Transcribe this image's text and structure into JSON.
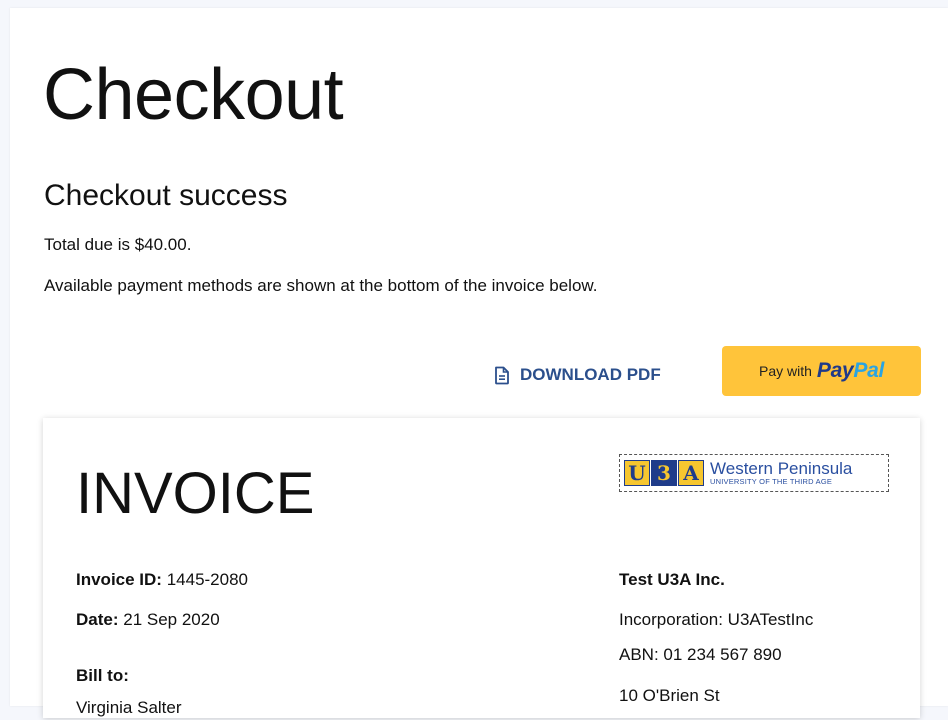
{
  "page": {
    "title": "Checkout",
    "subtitle": "Checkout success",
    "total_line": "Total due is $40.00.",
    "methods_line": "Available payment methods are shown at the bottom of the invoice below."
  },
  "actions": {
    "download_label": "DOWNLOAD PDF",
    "download_icon": "file-document-icon",
    "paypal_prefix": "Pay with",
    "paypal_brand_a": "Pay",
    "paypal_brand_b": "Pal"
  },
  "invoice": {
    "heading": "INVOICE",
    "id_label": "Invoice ID:",
    "id_value": "1445-2080",
    "date_label": "Date:",
    "date_value": "21 Sep 2020",
    "bill_to_label": "Bill to:",
    "bill_to_name": "Virginia Salter",
    "logo": {
      "letters": [
        "U",
        "3",
        "A"
      ],
      "name": "Western Peninsula",
      "tagline": "UNIVERSITY OF THE THIRD AGE"
    },
    "org": {
      "name": "Test U3A Inc.",
      "incorporation": "Incorporation: U3ATestInc",
      "abn": "ABN: 01 234 567 890",
      "street": "10 O'Brien St"
    }
  },
  "colors": {
    "accent": "#2b4f8c",
    "paypal_button": "#ffc43a",
    "background": "#f5f7fc"
  }
}
